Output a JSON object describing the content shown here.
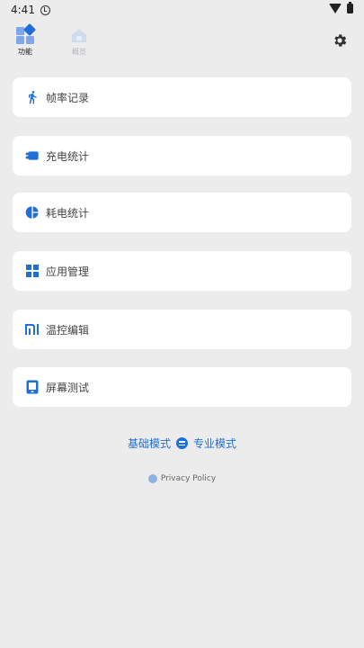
{
  "status_bar": {
    "time": "4:41"
  },
  "tabs": [
    {
      "label": "功能",
      "active": true
    },
    {
      "label": "概览",
      "active": false
    }
  ],
  "menu": [
    {
      "label": "帧率记录",
      "icon": "running-icon"
    },
    {
      "label": "充电统计",
      "icon": "charging-icon"
    },
    {
      "label": "耗电统计",
      "icon": "pie-chart-icon"
    },
    {
      "label": "应用管理",
      "icon": "grid-icon"
    },
    {
      "label": "温控编辑",
      "icon": "mi-logo-icon"
    },
    {
      "label": "屏幕测试",
      "icon": "phone-screen-icon"
    }
  ],
  "mode_switch": {
    "basic": "基础模式",
    "pro": "专业模式"
  },
  "privacy": {
    "label": "Privacy Policy"
  },
  "colors": {
    "accent": "#1f6fd6",
    "background": "#ececec",
    "card": "#ffffff"
  }
}
